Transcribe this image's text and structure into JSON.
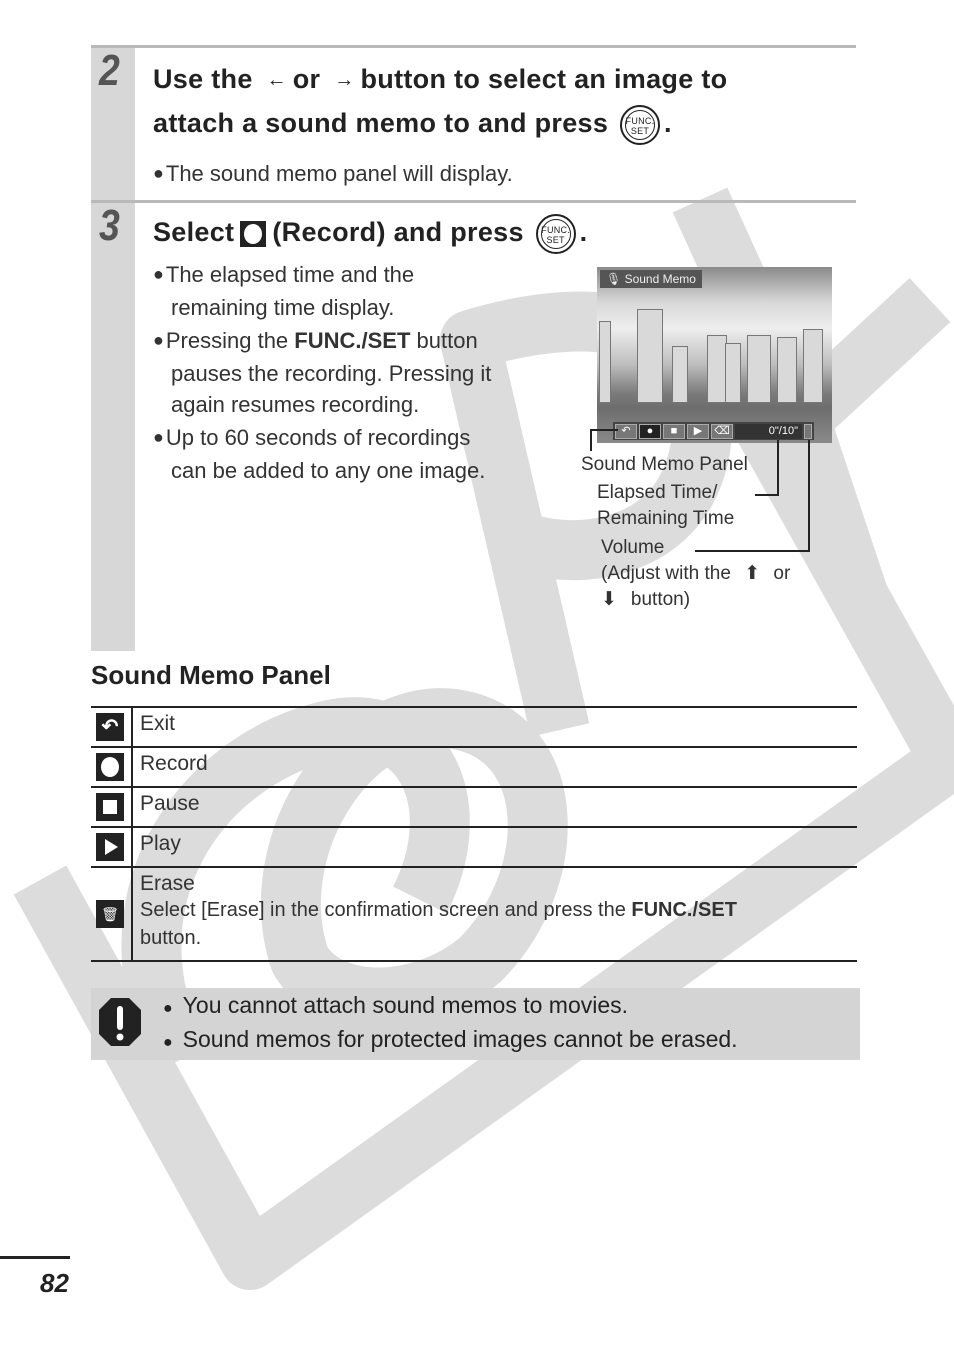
{
  "watermark": {
    "text": "COPY",
    "color": "#dcdcdc"
  },
  "step2": {
    "number": "2",
    "title_line1_a": "Use the",
    "title_line1_b": "or",
    "title_line1_c": "button to select an image to",
    "title_line2": "attach a sound memo to and press",
    "left_arrow_icon": "←",
    "right_arrow_icon": "→",
    "func_icon": {
      "top": "FUNC.",
      "bottom": "SET"
    },
    "bullets": [
      "The sound memo panel will display."
    ]
  },
  "step3": {
    "number": "3",
    "title_a": "Select",
    "title_b": "(Record) and press",
    "func_icon": {
      "top": "FUNC.",
      "bottom": "SET"
    },
    "bullets": [
      {
        "line1": "The elapsed time and the",
        "line2": "remaining time display."
      },
      {
        "line1_a": "Pressing the",
        "line1_bold": "FUNC./SET",
        "line1_b": "button",
        "line2": "pauses the recording. Pressing it",
        "line3": "again resumes recording."
      },
      {
        "line1": "Up to 60 seconds of recordings",
        "line2": "can be added to any one image."
      }
    ]
  },
  "camera_screen": {
    "label": "Sound Memo",
    "mic_icon": "🎙",
    "time_readout": "0\"/10\"",
    "buttons": [
      "exit",
      "record",
      "pause",
      "play",
      "erase"
    ]
  },
  "callouts": {
    "panel": "Sound Memo Panel",
    "elapsed_line1": "Elapsed Time/",
    "elapsed_line2": "Remaining Time",
    "volume": "Volume",
    "adjust_a": "(Adjust with the",
    "adjust_b": "or",
    "adjust_c": "button)"
  },
  "section": {
    "title": "Sound Memo Panel",
    "rows": [
      {
        "icon": "exit-icon",
        "label": "Exit"
      },
      {
        "icon": "record-icon",
        "label": "Record"
      },
      {
        "icon": "pause-icon",
        "label": "Pause"
      },
      {
        "icon": "play-icon",
        "label": "Play"
      },
      {
        "icon": "erase-icon",
        "label": "Erase",
        "desc_a": "Select [Erase] in the confirmation screen and press the",
        "desc_bold": "FUNC./SET",
        "desc_b": "button."
      }
    ]
  },
  "caution": {
    "items": [
      "You cannot attach sound memos to movies.",
      "Sound memos for protected images cannot be erased."
    ]
  },
  "page_number": "82"
}
